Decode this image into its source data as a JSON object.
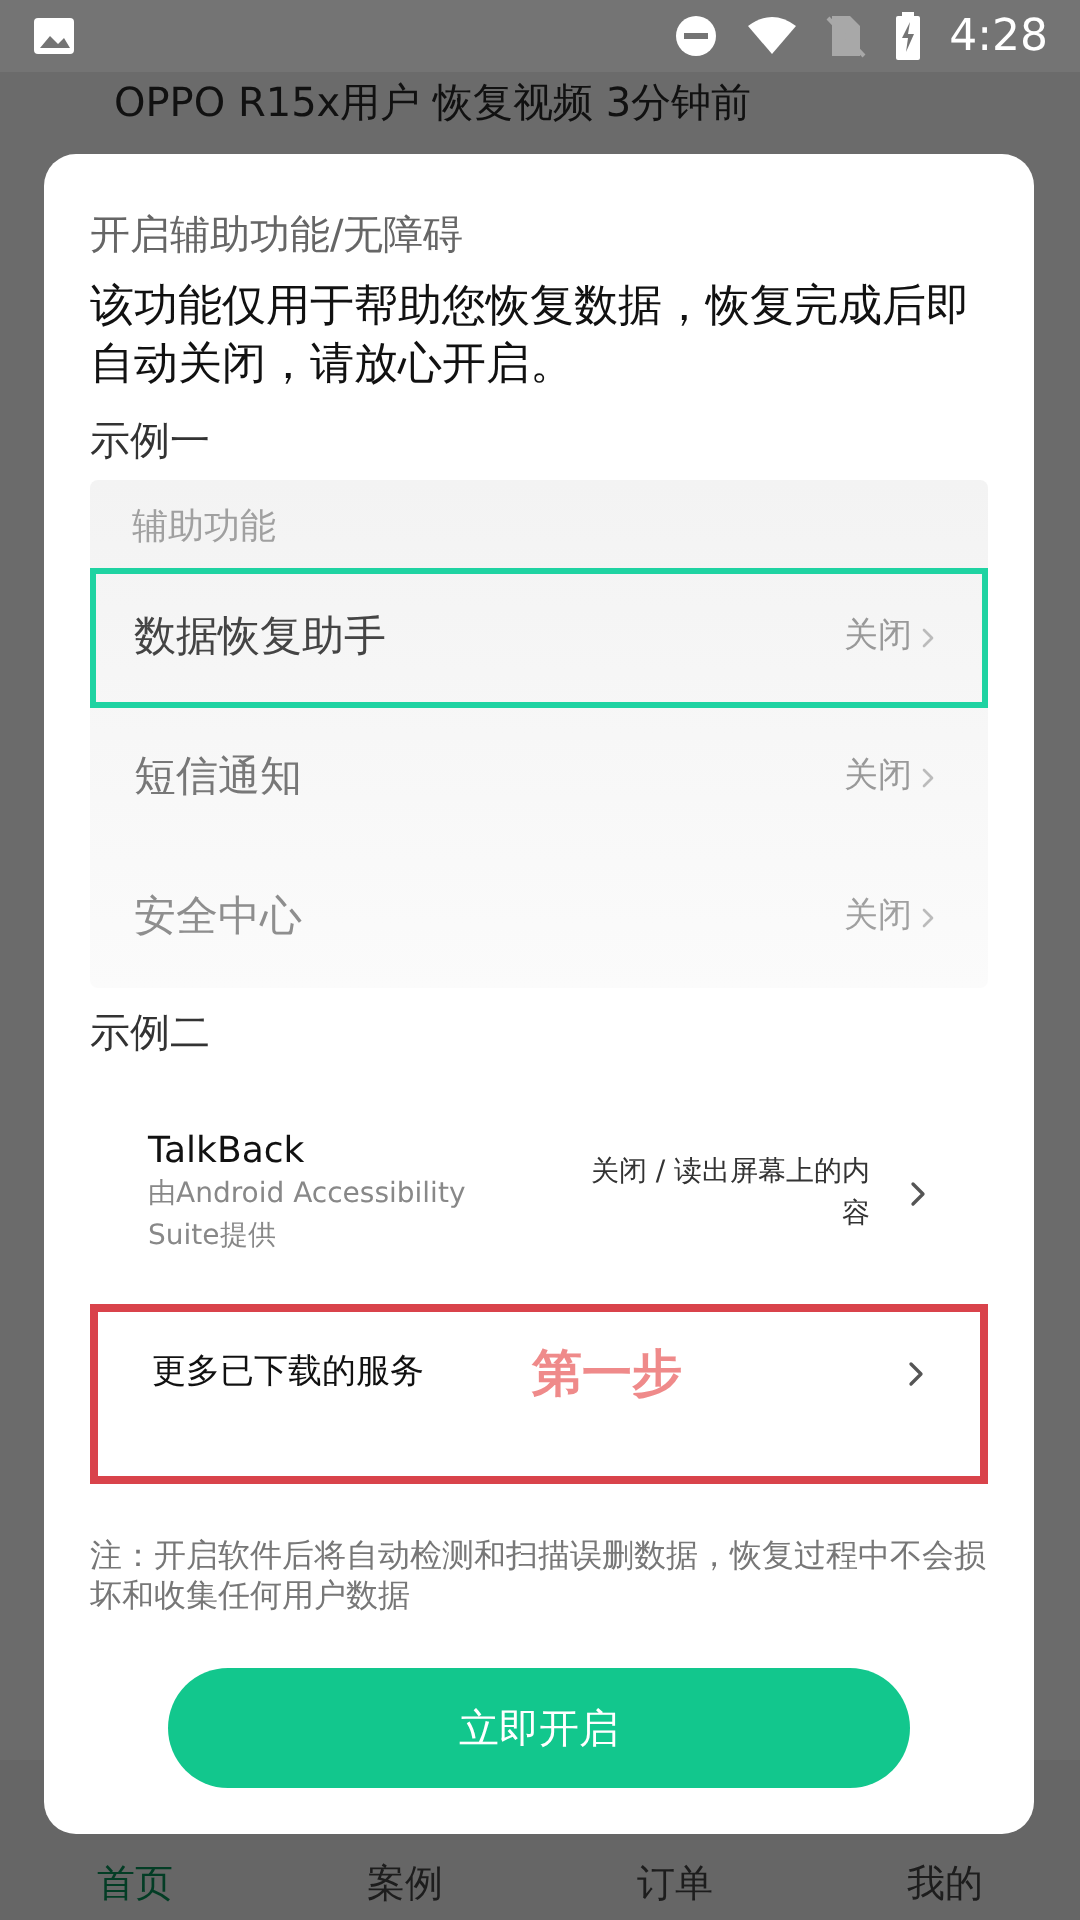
{
  "status_bar": {
    "time": "4:28"
  },
  "background": {
    "headline": "OPPO R15x用户 恢复视频 3分钟前"
  },
  "dialog": {
    "title": "开启辅助功能/无障碍",
    "message": "该功能仅用于帮助您恢复数据，恢复完成后即自动关闭，请放心开启。",
    "example_1": {
      "label": "示例一",
      "header": "辅助功能",
      "rows": [
        {
          "name": "数据恢复助手",
          "status": "关闭",
          "selected": true
        },
        {
          "name": "短信通知",
          "status": "关闭",
          "selected": false
        },
        {
          "name": "安全中心",
          "status": "关闭",
          "selected": false
        }
      ]
    },
    "example_2": {
      "label": "示例二",
      "service": {
        "name": "TalkBack",
        "subtitle": "由Android Accessibility Suite提供",
        "status": "关闭 / 读出屏幕上的内容"
      },
      "more": {
        "label": "更多已下载的服务",
        "step": "第一步",
        "selected": true
      }
    },
    "note": "注：开启软件后将自动检测和扫描误删数据，恢复过程中不会损坏和收集任何用户数据",
    "button": "立即开启"
  },
  "bottom_nav": [
    {
      "label": "首页",
      "selected": true
    },
    {
      "label": "案例",
      "selected": false
    },
    {
      "label": "订单",
      "selected": false
    },
    {
      "label": "我的",
      "selected": false
    }
  ]
}
